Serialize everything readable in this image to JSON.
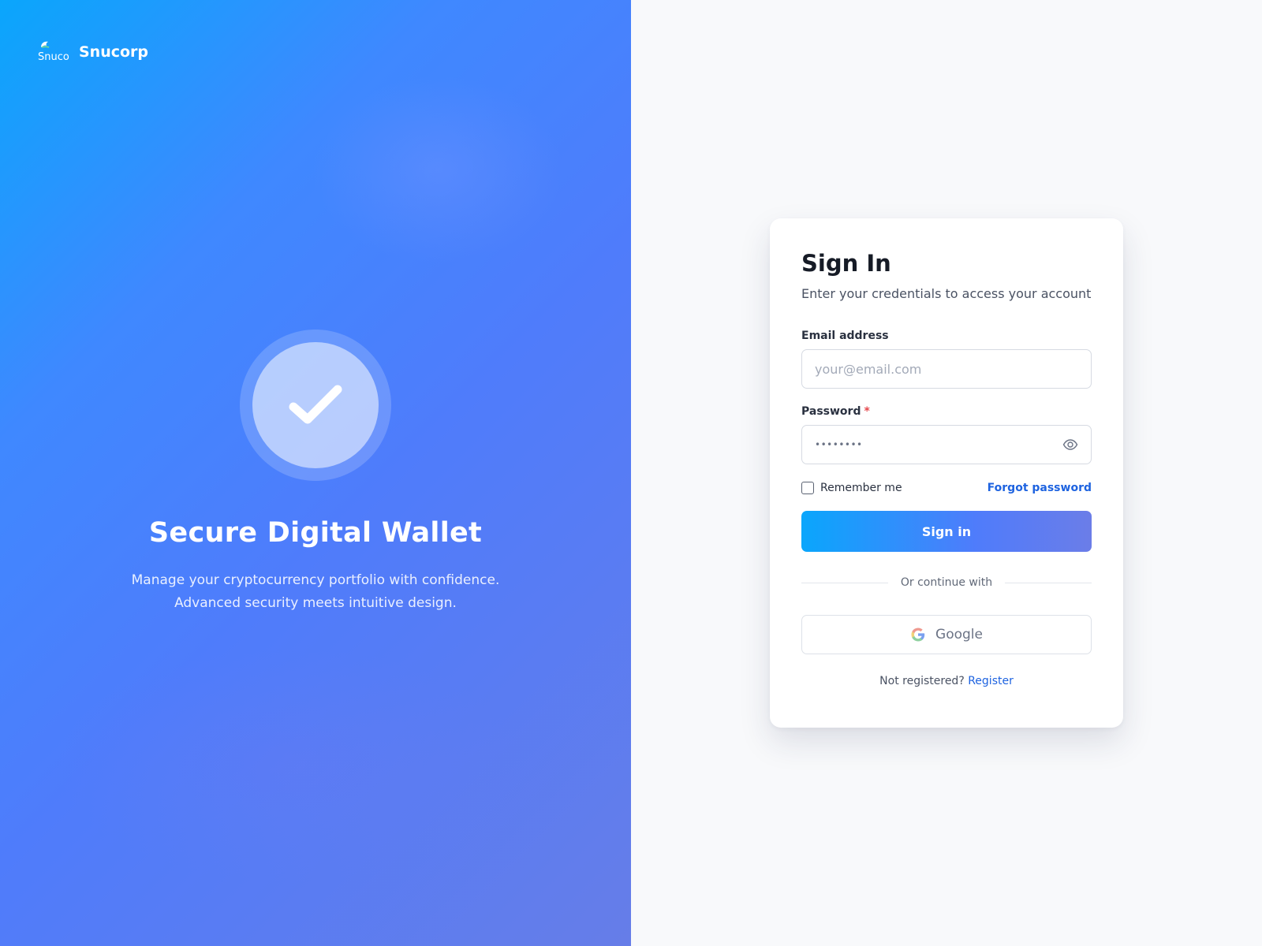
{
  "brand": {
    "name": "Snucorp",
    "logo_text": "Snucorp"
  },
  "hero": {
    "title": "Secure Digital Wallet",
    "subtitle_line1": "Manage your cryptocurrency portfolio with confidence.",
    "subtitle_line2": "Advanced security meets intuitive design.",
    "icon": "check-icon"
  },
  "signin": {
    "title": "Sign In",
    "subtitle": "Enter your credentials to access your account",
    "email": {
      "label": "Email address",
      "placeholder": "your@email.com",
      "value": ""
    },
    "password": {
      "label": "Password",
      "required_mark": "*",
      "masked_value": "••••••••",
      "toggle_icon": "eye-icon"
    },
    "remember_label": "Remember me",
    "remember_checked": false,
    "forgot_label": "Forgot password",
    "submit_label": "Sign in",
    "divider_label": "Or continue with",
    "google_label": "Google",
    "register_prompt": "Not registered?",
    "register_label": "Register"
  },
  "colors": {
    "accent": "#1e63e0",
    "gradient_start": "#0aa6fc",
    "gradient_end": "#667de8",
    "required": "#e5484d"
  }
}
